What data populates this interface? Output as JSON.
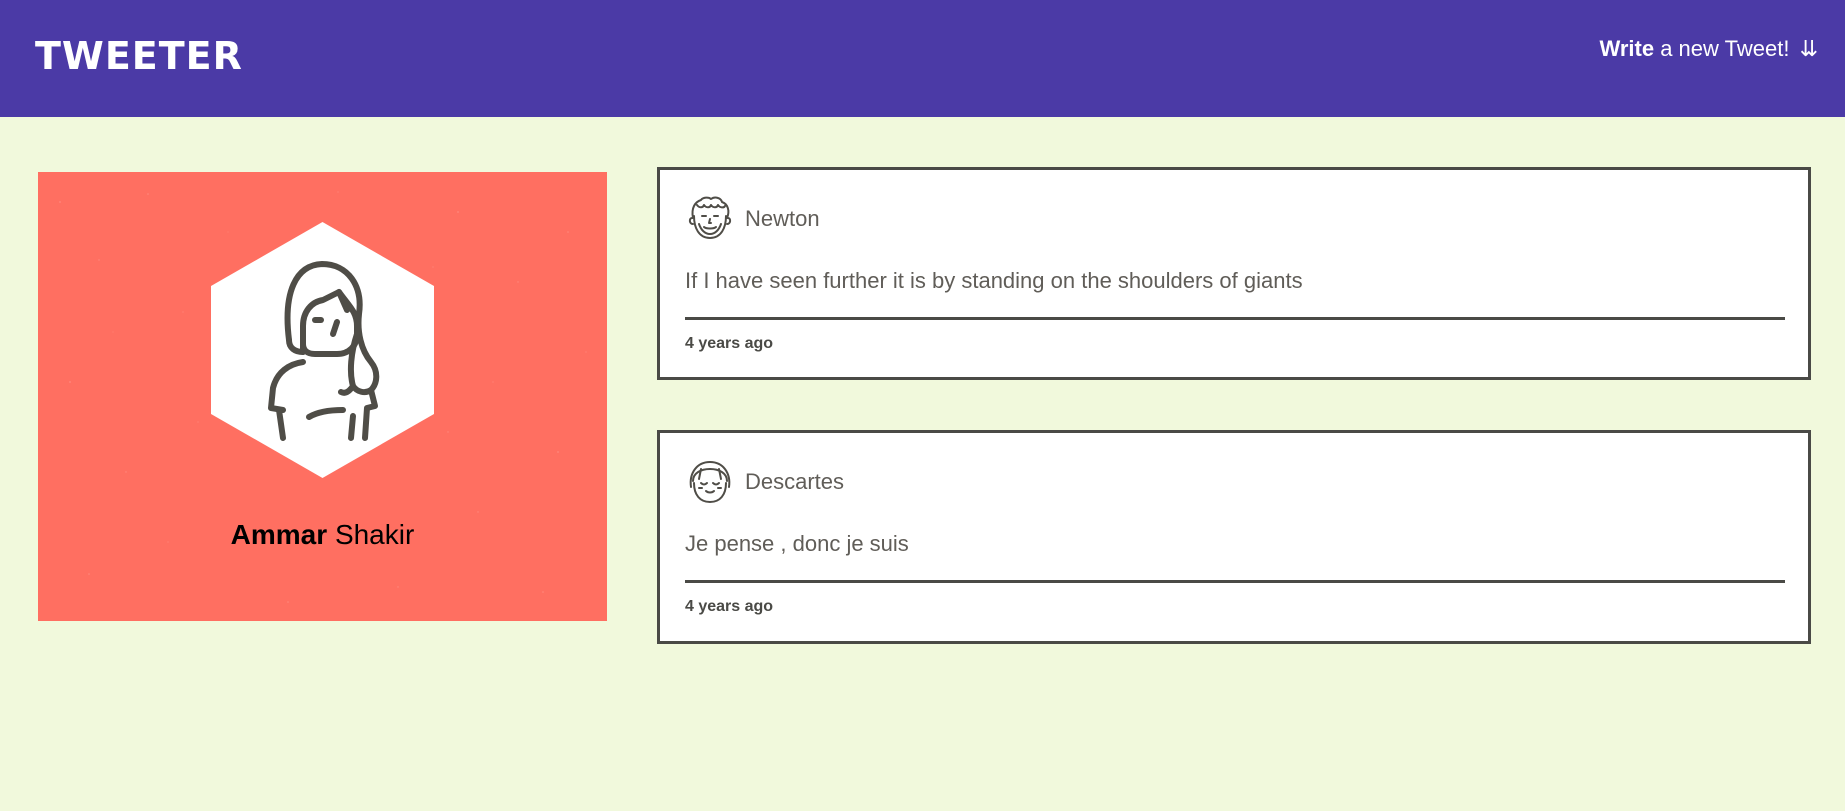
{
  "nav": {
    "brand": "TWEETER",
    "compose_strong": "Write",
    "compose_rest": " a new Tweet!",
    "compose_arrow": "⇊"
  },
  "profile": {
    "first_name": "Ammar",
    "last_name": "Shakir",
    "avatar_icon": "woman-avatar-icon",
    "background_color": "#ff6f61"
  },
  "tweets": [
    {
      "author": "Newton",
      "avatar_icon": "bearded-man-avatar-icon",
      "text": "If I have seen further it is by standing on the shoulders of giants",
      "time": "4 years ago"
    },
    {
      "author": "Descartes",
      "avatar_icon": "bob-haircut-avatar-icon",
      "text": "Je pense , donc je suis",
      "time": "4 years ago"
    }
  ],
  "colors": {
    "nav": "#4b3aa6",
    "page": "#f1f9dc",
    "card_border": "#4a4a46",
    "text_muted": "#605d58"
  }
}
